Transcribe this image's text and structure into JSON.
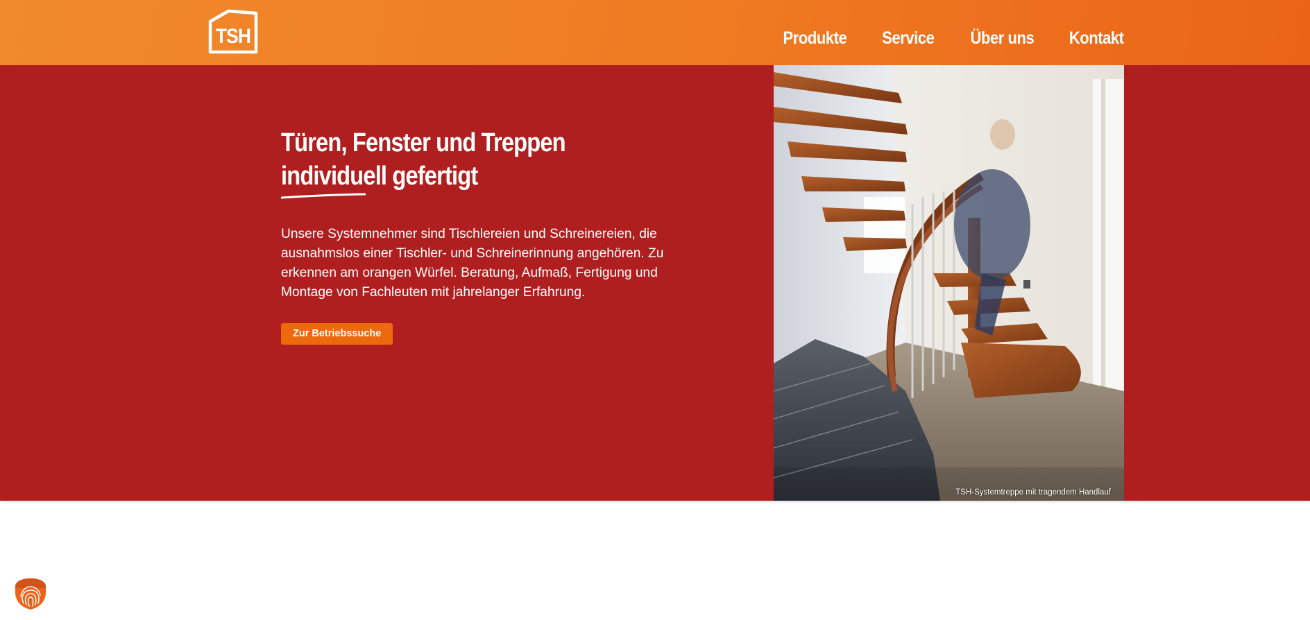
{
  "brand": {
    "logo_text": "TSH",
    "header_color": "#ef7a22",
    "hero_color": "#af1f1f",
    "accent_color": "#ec6a0c"
  },
  "nav": {
    "items": [
      {
        "label": "Produkte"
      },
      {
        "label": "Service"
      },
      {
        "label": "Über uns"
      },
      {
        "label": "Kontakt"
      }
    ]
  },
  "hero": {
    "headline_line1": "Türen, Fenster und Treppen",
    "headline_line2": "individuell gefertigt",
    "body": "Unsere Systemnehmer sind Tischlereien und Schreinereien, die ausnahmslos einer Tischler- und Schreinerinnung angehören. Zu erkennen am orangen Würfel. Beratung, Aufmaß, Fertigung und Montage von Fachleuten mit jahrelanger Erfahrung.",
    "cta_label": "Zur Betriebssuche",
    "image_caption": "TSH-Systemtreppe mit tragendem Handlauf"
  },
  "icons": {
    "logo": "tsh-house-logo",
    "privacy": "fingerprint-shield-icon"
  }
}
